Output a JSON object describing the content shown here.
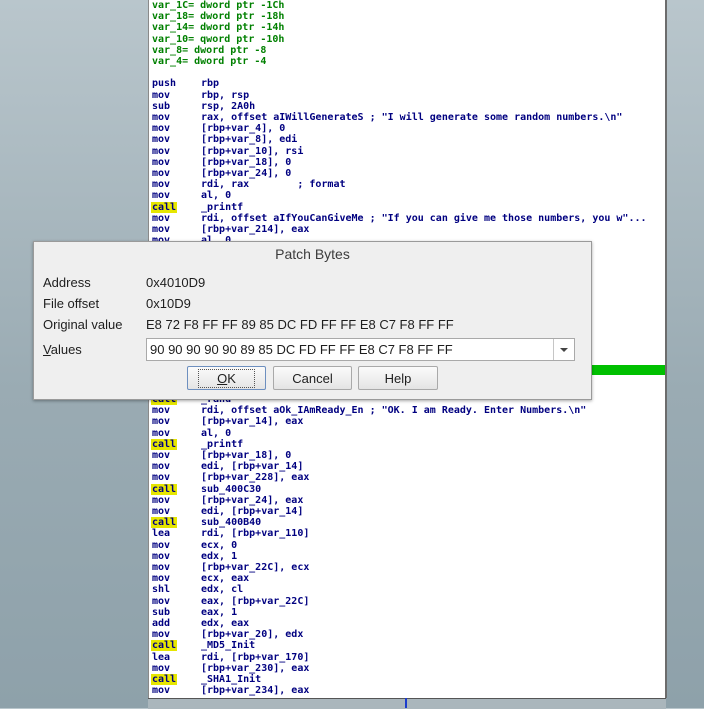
{
  "dialog": {
    "title": "Patch Bytes",
    "address_label": "Address",
    "address_value": "0x4010D9",
    "file_offset_label": "File offset",
    "file_offset_value": "0x10D9",
    "original_label": "Original value",
    "original_value": "E8 72 F8 FF FF 89 85 DC FD FF FF E8 C7 F8 FF FF",
    "values_label_accel": "V",
    "values_label_rest": "alues",
    "values_value": "90 90 90 90 90 89 85 DC FD FF FF E8 C7 F8 FF FF",
    "ok_accel": "O",
    "ok_rest": "K",
    "cancel_label": "Cancel",
    "help_label": "Help"
  },
  "disasm_top": [
    {
      "kind": "def",
      "text": "var_1C= dword ptr -1Ch"
    },
    {
      "kind": "def",
      "text": "var_18= dword ptr -18h"
    },
    {
      "kind": "def",
      "text": "var_14= dword ptr -14h"
    },
    {
      "kind": "def",
      "text": "var_10= qword ptr -10h"
    },
    {
      "kind": "def",
      "text": "var_8= dword ptr -8"
    },
    {
      "kind": "def",
      "text": "var_4= dword ptr -4"
    },
    {
      "kind": "blank",
      "text": ""
    },
    {
      "kind": "ins",
      "mn": "push",
      "op": "rbp"
    },
    {
      "kind": "ins",
      "mn": "mov",
      "op": "rbp, rsp"
    },
    {
      "kind": "ins",
      "mn": "sub",
      "op": "rsp, 2A0h"
    },
    {
      "kind": "ins",
      "mn": "mov",
      "op": "rax, offset aIWillGenerateS ; \"I will generate some random numbers.\\n\""
    },
    {
      "kind": "ins",
      "mn": "mov",
      "op": "[rbp+var_4], 0"
    },
    {
      "kind": "ins",
      "mn": "mov",
      "op": "[rbp+var_8], edi"
    },
    {
      "kind": "ins",
      "mn": "mov",
      "op": "[rbp+var_10], rsi"
    },
    {
      "kind": "ins",
      "mn": "mov",
      "op": "[rbp+var_18], 0"
    },
    {
      "kind": "ins",
      "mn": "mov",
      "op": "[rbp+var_24], 0"
    },
    {
      "kind": "ins",
      "mn": "mov",
      "op": "rdi, rax        ; format"
    },
    {
      "kind": "ins",
      "mn": "mov",
      "op": "al, 0"
    },
    {
      "kind": "call",
      "mn": "call",
      "op": "_printf"
    },
    {
      "kind": "ins",
      "mn": "mov",
      "op": "rdi, offset aIfYouCanGiveMe ; \"If you can give me those numbers, you w\"..."
    },
    {
      "kind": "ins",
      "mn": "mov",
      "op": "[rbp+var_214], eax"
    },
    {
      "kind": "ins",
      "mn": "mov",
      "op": "al, 0"
    }
  ],
  "disasm_bottom": [
    {
      "kind": "call",
      "mn": "call",
      "op": "_rand"
    },
    {
      "kind": "ins",
      "mn": "mov",
      "op": "rdi, offset aOk_IAmReady_En ; \"OK. I am Ready. Enter Numbers.\\n\""
    },
    {
      "kind": "ins",
      "mn": "mov",
      "op": "[rbp+var_14], eax"
    },
    {
      "kind": "ins",
      "mn": "mov",
      "op": "al, 0"
    },
    {
      "kind": "call",
      "mn": "call",
      "op": "_printf"
    },
    {
      "kind": "ins",
      "mn": "mov",
      "op": "[rbp+var_18], 0"
    },
    {
      "kind": "ins",
      "mn": "mov",
      "op": "edi, [rbp+var_14]"
    },
    {
      "kind": "ins",
      "mn": "mov",
      "op": "[rbp+var_228], eax"
    },
    {
      "kind": "call",
      "mn": "call",
      "op": "sub_400C30"
    },
    {
      "kind": "ins",
      "mn": "mov",
      "op": "[rbp+var_24], eax"
    },
    {
      "kind": "ins",
      "mn": "mov",
      "op": "edi, [rbp+var_14]"
    },
    {
      "kind": "call",
      "mn": "call",
      "op": "sub_400B40"
    },
    {
      "kind": "ins",
      "mn": "lea",
      "op": "rdi, [rbp+var_110]"
    },
    {
      "kind": "ins",
      "mn": "mov",
      "op": "ecx, 0"
    },
    {
      "kind": "ins",
      "mn": "mov",
      "op": "edx, 1"
    },
    {
      "kind": "ins",
      "mn": "mov",
      "op": "[rbp+var_22C], ecx"
    },
    {
      "kind": "ins",
      "mn": "mov",
      "op": "ecx, eax"
    },
    {
      "kind": "ins",
      "mn": "shl",
      "op": "edx, cl"
    },
    {
      "kind": "ins",
      "mn": "mov",
      "op": "eax, [rbp+var_22C]"
    },
    {
      "kind": "ins",
      "mn": "sub",
      "op": "eax, 1"
    },
    {
      "kind": "ins",
      "mn": "add",
      "op": "edx, eax"
    },
    {
      "kind": "ins",
      "mn": "mov",
      "op": "[rbp+var_20], edx"
    },
    {
      "kind": "call",
      "mn": "call",
      "op": "_MD5_Init"
    },
    {
      "kind": "ins",
      "mn": "lea",
      "op": "rdi, [rbp+var_170]"
    },
    {
      "kind": "ins",
      "mn": "mov",
      "op": "[rbp+var_230], eax"
    },
    {
      "kind": "call",
      "mn": "call",
      "op": "_SHA1_Init"
    },
    {
      "kind": "ins",
      "mn": "mov",
      "op": "[rbp+var_234], eax"
    }
  ]
}
